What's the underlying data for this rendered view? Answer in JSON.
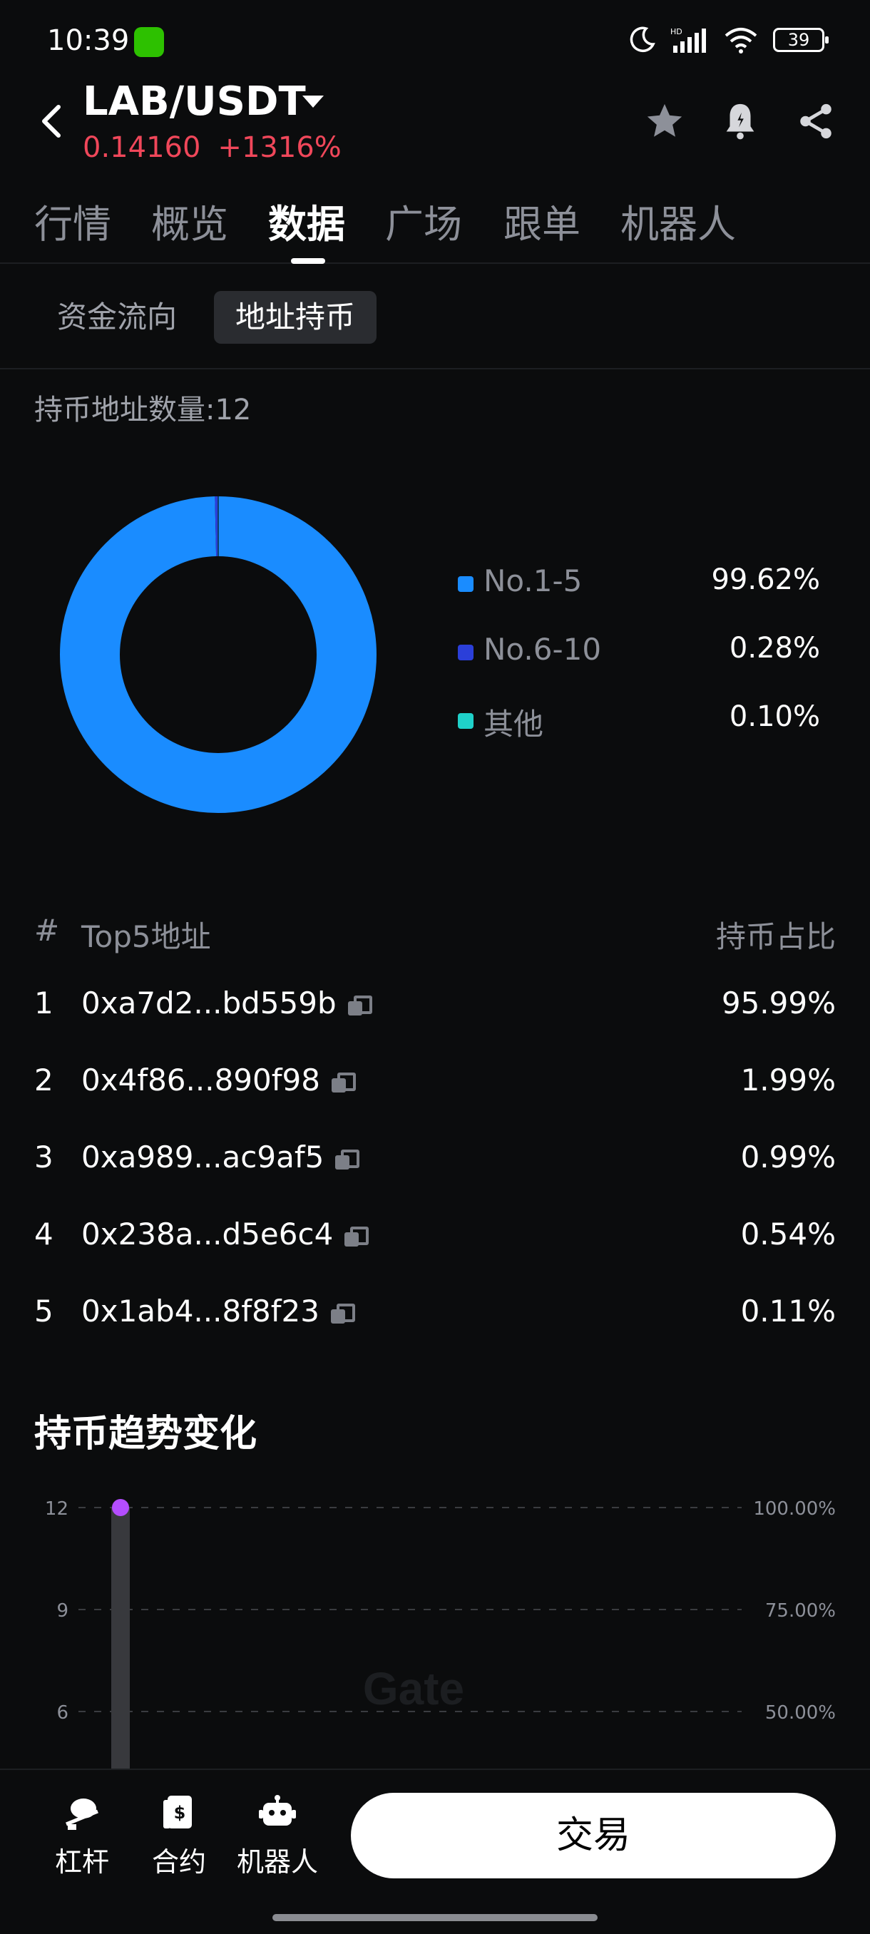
{
  "status_bar": {
    "time": "10:39",
    "battery": "39"
  },
  "header": {
    "pair": "LAB/USDT",
    "price": "0.14160",
    "change": "+1316%"
  },
  "main_tabs": [
    "行情",
    "概览",
    "数据",
    "广场",
    "跟单",
    "机器人"
  ],
  "main_tabs_active": "数据",
  "sub_tabs": [
    "资金流向",
    "地址持币"
  ],
  "sub_tabs_active": "地址持币",
  "holder_count_text": "持币地址数量:12",
  "distribution": {
    "legend": [
      {
        "label": "No.1-5",
        "value": "99.62%",
        "color": "#1a8cff"
      },
      {
        "label": "No.6-10",
        "value": "0.28%",
        "color": "#2b3fd9"
      },
      {
        "label": "其他",
        "value": "0.10%",
        "color": "#1fd1c9"
      }
    ],
    "slices": [
      99.62,
      0.28,
      0.1
    ]
  },
  "top5": {
    "headers": {
      "num": "#",
      "address": "Top5地址",
      "share": "持币占比"
    },
    "rows": [
      {
        "rank": "1",
        "address": "0xa7d2...bd559b",
        "share": "95.99%"
      },
      {
        "rank": "2",
        "address": "0x4f86...890f98",
        "share": "1.99%"
      },
      {
        "rank": "3",
        "address": "0xa989...ac9af5",
        "share": "0.99%"
      },
      {
        "rank": "4",
        "address": "0x238a...d5e6c4",
        "share": "0.54%"
      },
      {
        "rank": "5",
        "address": "0x1ab4...8f8f23",
        "share": "0.11%"
      }
    ]
  },
  "trend": {
    "title": "持币趋势变化",
    "watermark": "Gate"
  },
  "chart_data": {
    "type": "bar",
    "title": "",
    "y_left_ticks": [
      "12",
      "9",
      "6"
    ],
    "y_right_ticks": [
      "100.00%",
      "75.00%",
      "50.00%"
    ],
    "ylim": [
      0,
      12
    ],
    "values": [
      12
    ],
    "line_values_pct": [
      100
    ],
    "grid": true
  },
  "bottom_bar": {
    "items": [
      "杠杆",
      "合约",
      "机器人"
    ],
    "trade_label": "交易"
  },
  "colors": {
    "up": "#f0475a",
    "accent": "#1a8cff",
    "marker": "#b44dff"
  }
}
